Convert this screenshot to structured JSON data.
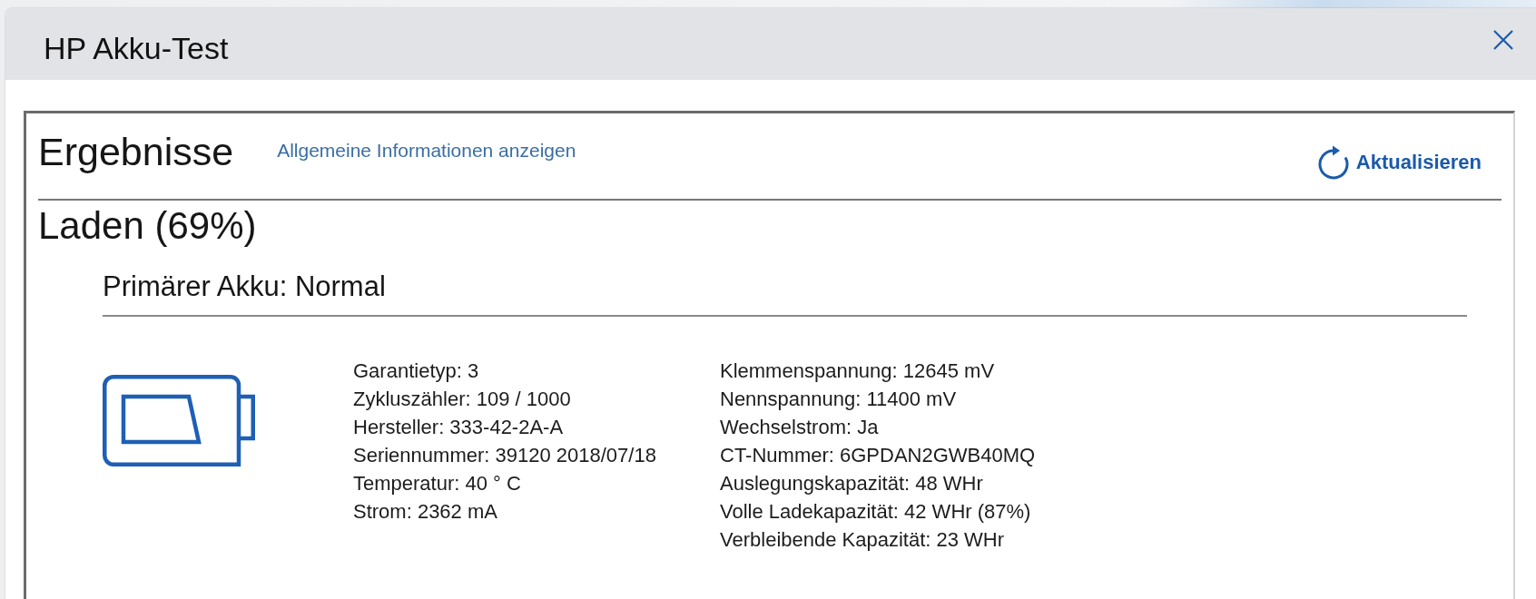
{
  "window": {
    "title": "HP Akku-Test"
  },
  "header": {
    "title": "Ergebnisse",
    "link": "Allgemeine Informationen anzeigen",
    "refresh_button": "Aktualisieren"
  },
  "status": {
    "title": "Laden (69%)"
  },
  "battery": {
    "title": "Primärer Akku: Normal",
    "column_1": [
      "Garantietyp: 3",
      "Zykluszähler: 109 / 1000",
      "Hersteller: 333-42-2A-A",
      "Seriennummer: 39120 2018/07/18",
      "Temperatur: 40 ° C",
      "Strom: 2362 mA"
    ],
    "column_2": [
      "Klemmenspannung: 12645 mV",
      "Nennspannung: 11400 mV",
      "Wechselstrom: Ja",
      "CT-Nummer: 6GPDAN2GWB40MQ",
      "Auslegungskapazität: 48 WHr",
      "Volle Ladekapazität: 42 WHr (87%)",
      "Verbleibende Kapazität: 23 WHr"
    ]
  }
}
